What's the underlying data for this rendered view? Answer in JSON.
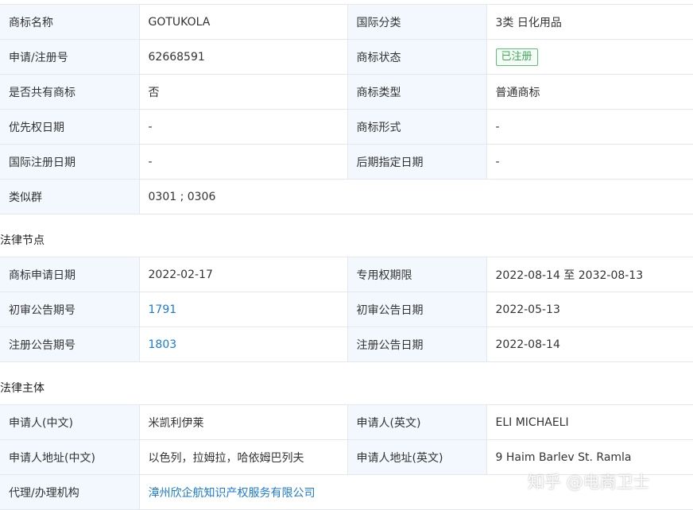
{
  "basic": {
    "r0": {
      "l1": "商标名称",
      "v1": "GOTUKOLA",
      "l2": "国际分类",
      "v2": "3类 日化用品"
    },
    "r1": {
      "l1": "申请/注册号",
      "v1": "62668591",
      "l2": "商标状态",
      "v2": "已注册"
    },
    "r2": {
      "l1": "是否共有商标",
      "v1": "否",
      "l2": "商标类型",
      "v2": "普通商标"
    },
    "r3": {
      "l1": "优先权日期",
      "v1": "-",
      "l2": "商标形式",
      "v2": "-"
    },
    "r4": {
      "l1": "国际注册日期",
      "v1": "-",
      "l2": "后期指定日期",
      "v2": "-"
    },
    "r5": {
      "l1": "类似群",
      "v1": "0301 ; 0306"
    }
  },
  "legal_nodes": {
    "title": "法律节点",
    "r0": {
      "l1": "商标申请日期",
      "v1": "2022-02-17",
      "l2": "专用权期限",
      "v2": "2022-08-14 至 2032-08-13"
    },
    "r1": {
      "l1": "初审公告期号",
      "v1": "1791",
      "l2": "初审公告日期",
      "v2": "2022-05-13"
    },
    "r2": {
      "l1": "注册公告期号",
      "v1": "1803",
      "l2": "注册公告日期",
      "v2": "2022-08-14"
    }
  },
  "legal_entity": {
    "title": "法律主体",
    "r0": {
      "l1": "申请人(中文)",
      "v1": "米凯利伊莱",
      "l2": "申请人(英文)",
      "v2": "ELI MICHAELI"
    },
    "r1": {
      "l1": "申请人地址(中文)",
      "v1": "以色列，拉姆拉，哈依姆巴列夫",
      "l2": "申请人地址(英文)",
      "v2": "9 Haim Barlev St. Ramla"
    },
    "r2": {
      "l1": "代理/办理机构",
      "v1": "漳州欣企航知识产权服务有限公司"
    }
  },
  "watermark": "知乎 @电商卫士",
  "colors": {
    "label_bg": "#f2f8fe",
    "border": "#e4e8ee",
    "link": "#1a7ad4",
    "status_green": "#3ea75a"
  }
}
